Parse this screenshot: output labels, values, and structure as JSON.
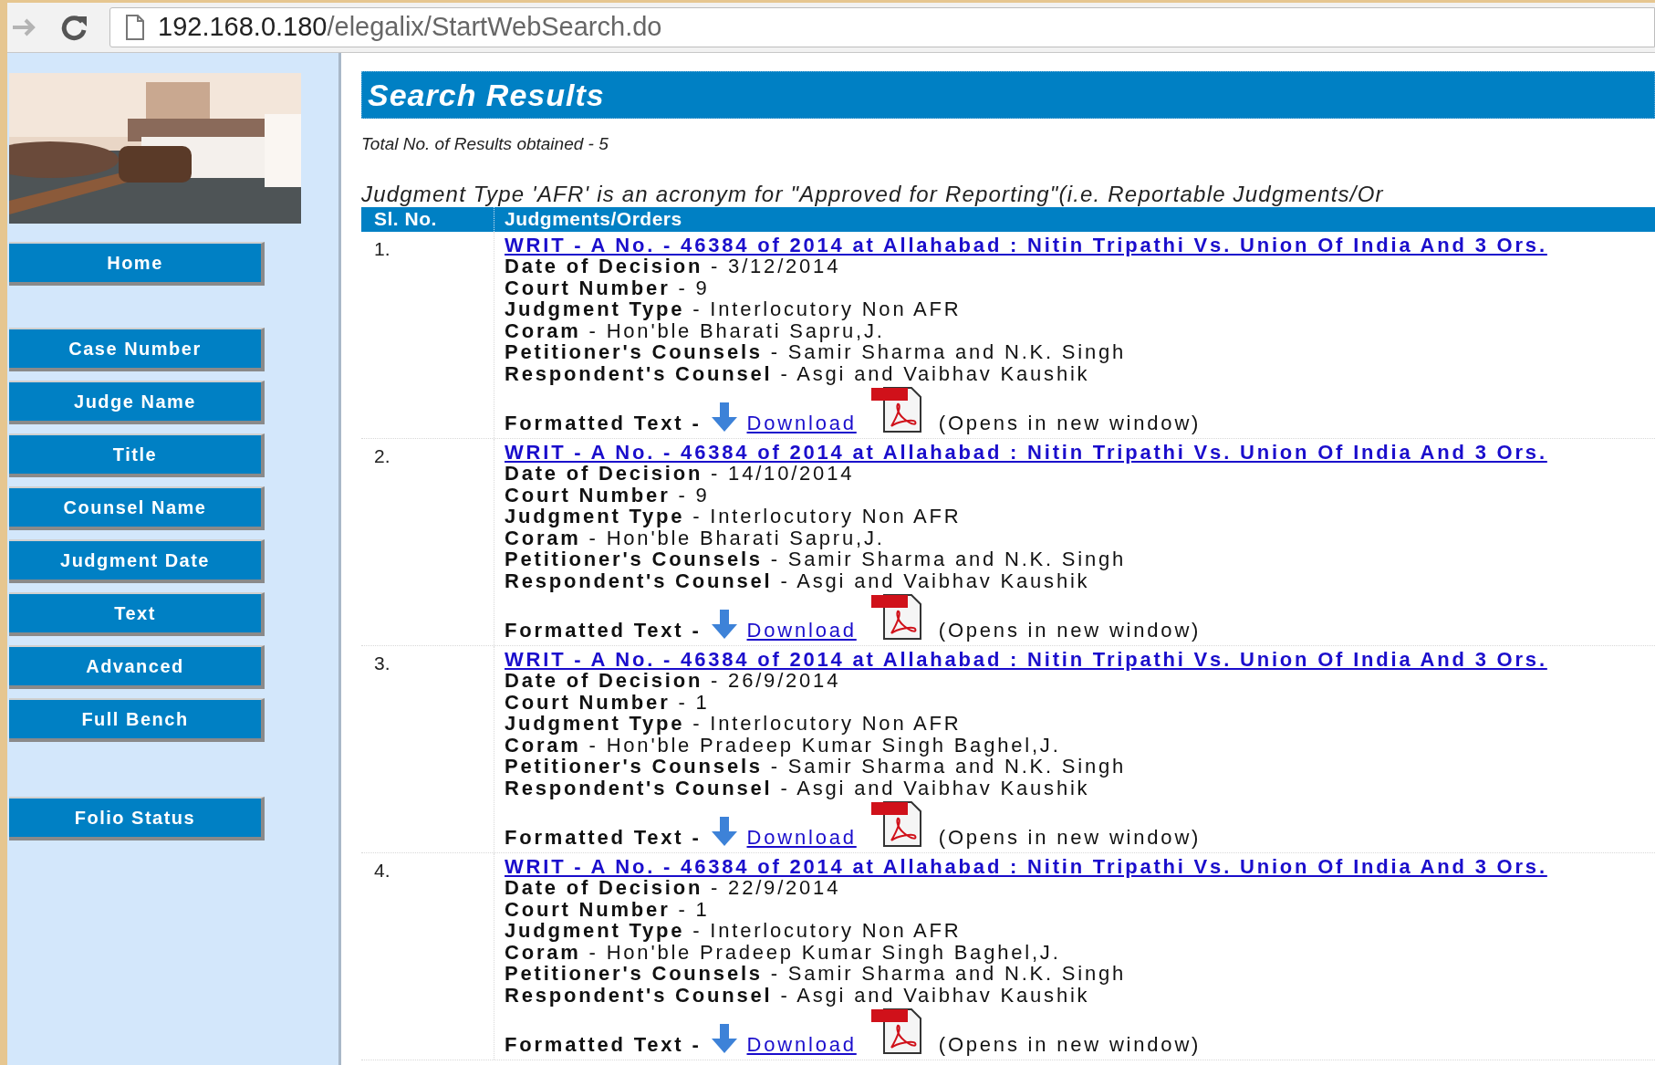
{
  "address_bar": {
    "host": "192.168.0.180",
    "path": "/elegalix/StartWebSearch.do"
  },
  "sidebar": {
    "button_groups": [
      [
        "Home"
      ],
      [
        "Case Number",
        "Judge Name",
        "Title",
        "Counsel Name",
        "Judgment Date",
        "Text",
        "Advanced",
        "Full Bench"
      ],
      [
        "Folio Status"
      ]
    ]
  },
  "title": "Search Results",
  "total": "Total No. of Results obtained - 5",
  "note": "Judgment Type 'AFR' is an acronym for \"Approved for Reporting\"(i.e. Reportable Judgments/Or",
  "table": {
    "columns": [
      "Sl. No.",
      "Judgments/Orders"
    ],
    "rows": [
      {
        "number": "1.",
        "title": "WRIT - A No. - 46384 of 2014 at Allahabad : Nitin Tripathi Vs. Union Of India And 3 Ors.",
        "fields": [
          "**Date of Decision** - 3/12/2014",
          "**Court Number** - 9",
          "**Judgment Type** - Interlocutory Non AFR",
          "**Coram** - Hon'ble Bharati Sapru,J.",
          "**Petitioner's Counsels** - Samir Sharma and N.K. Singh",
          "**Respondent's Counsel** - Asgi and Vaibhav Kaushik"
        ],
        "formatted_label": "Formatted Text -",
        "download": "Download",
        "opens": "(Opens in new window)"
      },
      {
        "number": "2.",
        "title": "WRIT - A No. - 46384 of 2014 at Allahabad : Nitin Tripathi Vs. Union Of India And 3 Ors.",
        "fields": [
          "**Date of Decision** - 14/10/2014",
          "**Court Number** - 9",
          "**Judgment Type** - Interlocutory Non AFR",
          "**Coram** - Hon'ble Bharati Sapru,J.",
          "**Petitioner's Counsels** - Samir Sharma and N.K. Singh",
          "**Respondent's Counsel** - Asgi and Vaibhav Kaushik"
        ],
        "formatted_label": "Formatted Text -",
        "download": "Download",
        "opens": "(Opens in new window)"
      },
      {
        "number": "3.",
        "title": "WRIT - A No. - 46384 of 2014 at Allahabad : Nitin Tripathi Vs. Union Of India And 3 Ors.",
        "fields": [
          "**Date of Decision** - 26/9/2014",
          "**Court Number** - 1",
          "**Judgment Type** - Interlocutory Non AFR",
          "**Coram** - Hon'ble Pradeep Kumar Singh Baghel,J.",
          "**Petitioner's Counsels** - Samir Sharma and N.K. Singh",
          "**Respondent's Counsel** - Asgi and Vaibhav Kaushik"
        ],
        "formatted_label": "Formatted Text -",
        "download": "Download",
        "opens": "(Opens in new window)"
      },
      {
        "number": "4.",
        "title": "WRIT - A No. - 46384 of 2014 at Allahabad : Nitin Tripathi Vs. Union Of India And 3 Ors.",
        "fields": [
          "**Date of Decision** - 22/9/2014",
          "**Court Number** - 1",
          "**Judgment Type** - Interlocutory Non AFR",
          "**Coram** - Hon'ble Pradeep Kumar Singh Baghel,J.",
          "**Petitioner's Counsels** - Samir Sharma and N.K. Singh",
          "**Respondent's Counsel** - Asgi and Vaibhav Kaushik"
        ],
        "formatted_label": "Formatted Text -",
        "download": "Download",
        "opens": "(Opens in new window)"
      }
    ]
  }
}
